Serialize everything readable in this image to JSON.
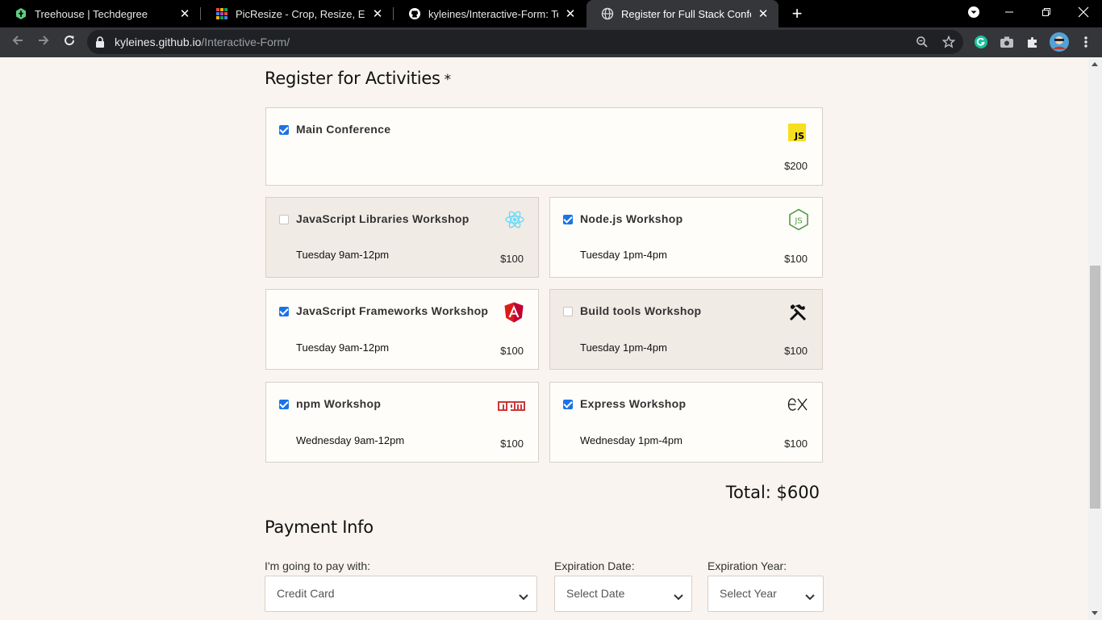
{
  "browser": {
    "tabs": [
      {
        "title": "Treehouse | Techdegree",
        "icon": "treehouse-icon"
      },
      {
        "title": "PicResize - Crop, Resize, Edit ima",
        "icon": "picresize-icon"
      },
      {
        "title": "kyleines/Interactive-Form: Team T",
        "icon": "github-icon"
      },
      {
        "title": "Register for Full Stack Conference",
        "icon": "globe-icon"
      }
    ],
    "url_host": "kyleines.github.io",
    "url_path": "/Interactive-Form/"
  },
  "activities": {
    "title": "Register for Activities",
    "required_marker": "*",
    "items": [
      {
        "name": "Main Conference",
        "time": "",
        "price": "$200",
        "checked": true,
        "disabled": false,
        "icon": "javascript-logo-icon"
      },
      {
        "name": "JavaScript Libraries Workshop",
        "time": "Tuesday 9am-12pm",
        "price": "$100",
        "checked": false,
        "disabled": true,
        "icon": "react-logo-icon"
      },
      {
        "name": "Node.js Workshop",
        "time": "Tuesday 1pm-4pm",
        "price": "$100",
        "checked": true,
        "disabled": false,
        "icon": "nodejs-logo-icon"
      },
      {
        "name": "JavaScript Frameworks Workshop",
        "time": "Tuesday 9am-12pm",
        "price": "$100",
        "checked": true,
        "disabled": false,
        "icon": "angular-logo-icon"
      },
      {
        "name": "Build tools Workshop",
        "time": "Tuesday 1pm-4pm",
        "price": "$100",
        "checked": false,
        "disabled": true,
        "icon": "tools-icon"
      },
      {
        "name": "npm Workshop",
        "time": "Wednesday 9am-12pm",
        "price": "$100",
        "checked": true,
        "disabled": false,
        "icon": "npm-logo-icon"
      },
      {
        "name": "Express Workshop",
        "time": "Wednesday 1pm-4pm",
        "price": "$100",
        "checked": true,
        "disabled": false,
        "icon": "express-logo-icon"
      }
    ],
    "total": "Total: $600"
  },
  "payment": {
    "title": "Payment Info",
    "method_label": "I'm going to pay with:",
    "method_value": "Credit Card",
    "exp_date_label": "Expiration Date:",
    "exp_date_value": "Select Date",
    "exp_year_label": "Expiration Year:",
    "exp_year_value": "Select Year"
  },
  "colors": {
    "page_bg": "#f9f4ef",
    "checkbox_blue": "#1a73e8",
    "js_yellow": "#f7df1e",
    "react_cyan": "#61dafb",
    "node_green": "#539e43",
    "angular_red": "#dd1b16",
    "npm_red": "#cb3837"
  }
}
